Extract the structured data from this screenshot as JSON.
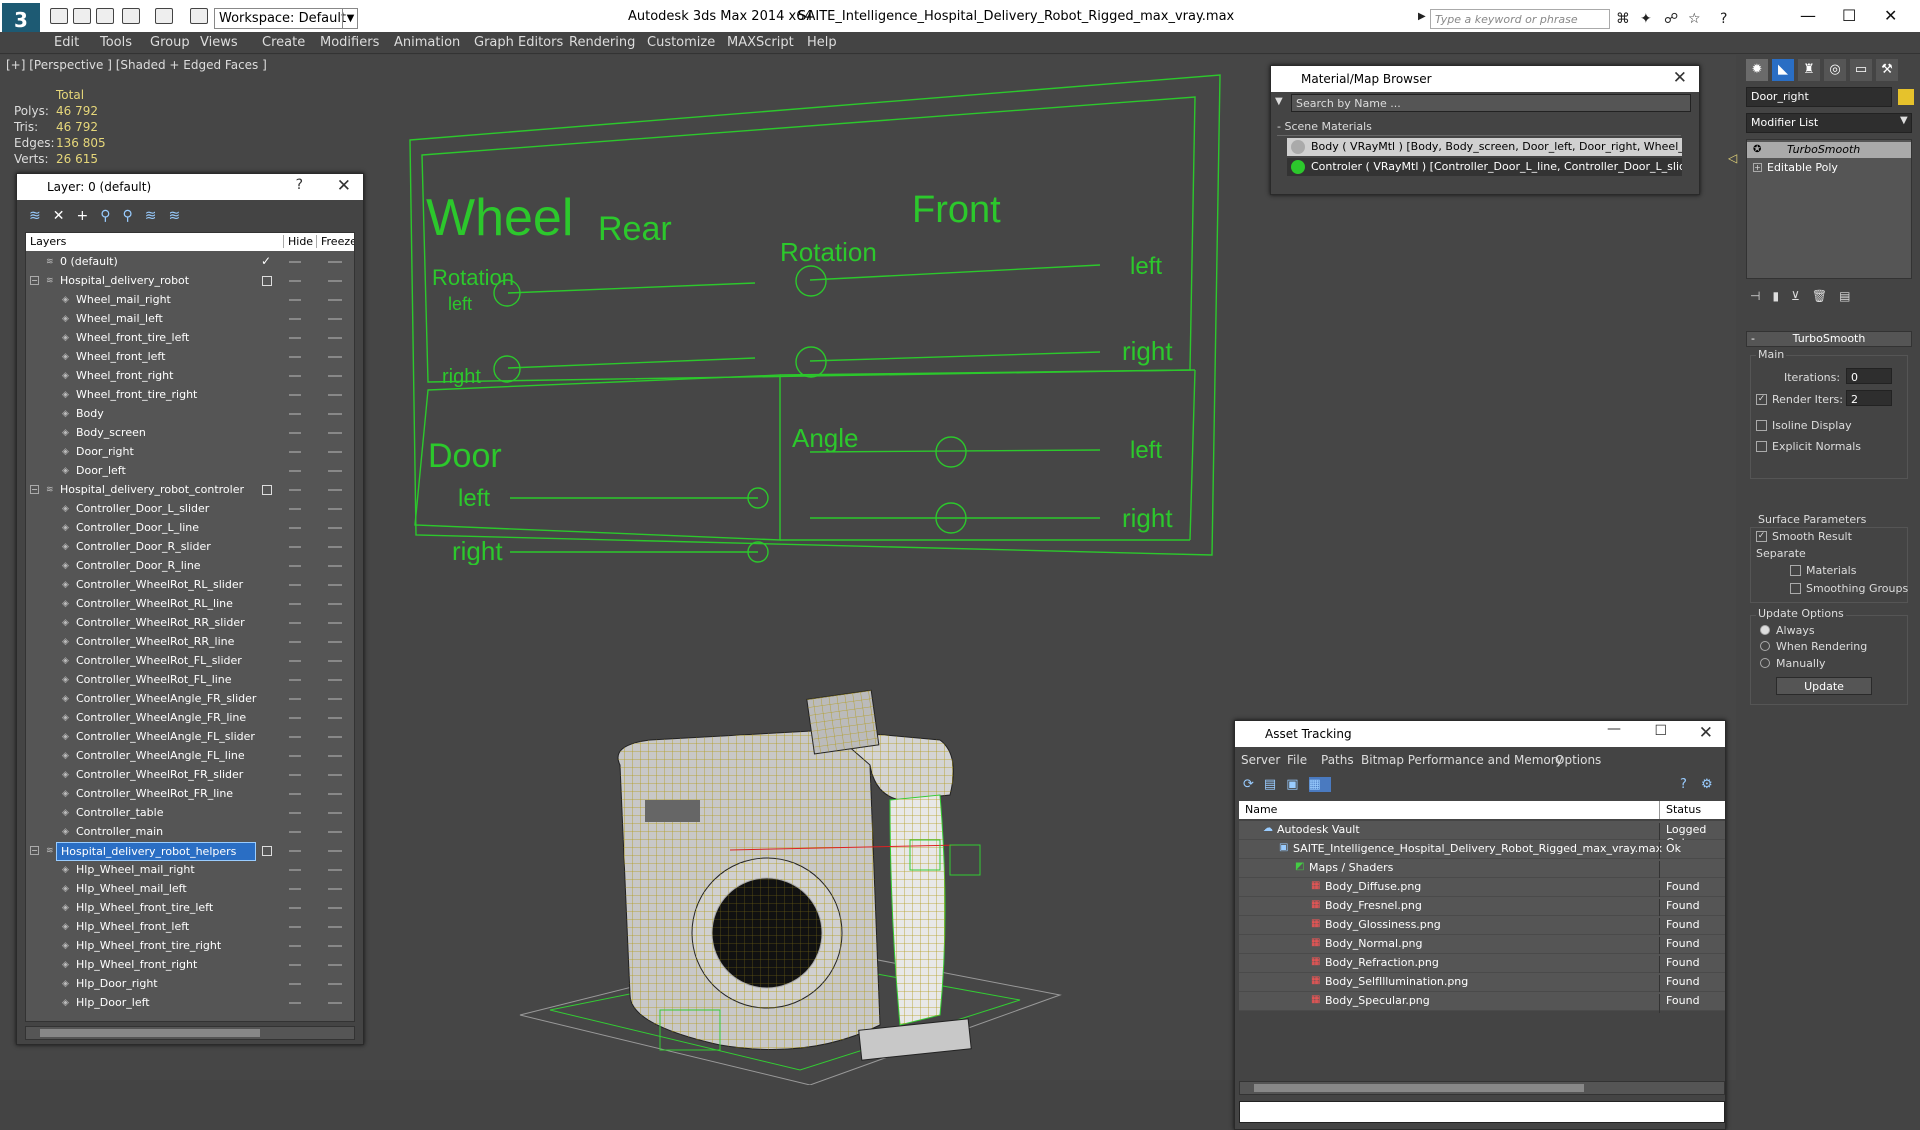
{
  "app": {
    "title": "Autodesk 3ds Max  2014 x64",
    "file": "SAITE_Intelligence_Hospital_Delivery_Robot_Rigged_max_vray.max",
    "workspace": "Workspace: Default",
    "search_placeholder": "Type a keyword or phrase",
    "logo": "3"
  },
  "menu": [
    "Edit",
    "Tools",
    "Group",
    "Views",
    "Create",
    "Modifiers",
    "Animation",
    "Graph Editors",
    "Rendering",
    "Customize",
    "MAXScript",
    "Help"
  ],
  "viewport": {
    "label": "[+] [Perspective ] [Shaded + Edged Faces ]",
    "stats": {
      "header": "Total",
      "polys_label": "Polys:",
      "polys": "46 792",
      "tris_label": "Tris:",
      "tris": "46 792",
      "edges_label": "Edges:",
      "edges": "136 805",
      "verts_label": "Verts:",
      "verts": "26 615"
    }
  },
  "rig_board": {
    "wheel": "Wheel",
    "rotation": "Rotation",
    "rear": "Rear",
    "front": "Front",
    "rotation2": "Rotation",
    "left": "left",
    "right": "right",
    "door": "Door",
    "angle": "Angle"
  },
  "layer_panel": {
    "title": "Layer: 0 (default)",
    "help": "?",
    "close": "✕",
    "col_layers": "Layers",
    "col_hide": "Hide",
    "col_freeze": "Freeze",
    "rows": [
      {
        "name": "0 (default)",
        "level": 0,
        "type": "layer"
      },
      {
        "name": "Hospital_delivery_robot",
        "level": 0,
        "type": "layer"
      },
      {
        "name": "Wheel_mail_right",
        "level": 1,
        "type": "obj"
      },
      {
        "name": "Wheel_mail_left",
        "level": 1,
        "type": "obj"
      },
      {
        "name": "Wheel_front_tire_left",
        "level": 1,
        "type": "obj"
      },
      {
        "name": "Wheel_front_left",
        "level": 1,
        "type": "obj"
      },
      {
        "name": "Wheel_front_right",
        "level": 1,
        "type": "obj"
      },
      {
        "name": "Wheel_front_tire_right",
        "level": 1,
        "type": "obj"
      },
      {
        "name": "Body",
        "level": 1,
        "type": "obj"
      },
      {
        "name": "Body_screen",
        "level": 1,
        "type": "obj"
      },
      {
        "name": "Door_right",
        "level": 1,
        "type": "obj"
      },
      {
        "name": "Door_left",
        "level": 1,
        "type": "obj"
      },
      {
        "name": "Hospital_delivery_robot_controler",
        "level": 0,
        "type": "layer"
      },
      {
        "name": "Controller_Door_L_slider",
        "level": 1,
        "type": "obj"
      },
      {
        "name": "Controller_Door_L_line",
        "level": 1,
        "type": "obj"
      },
      {
        "name": "Controller_Door_R_slider",
        "level": 1,
        "type": "obj"
      },
      {
        "name": "Controller_Door_R_line",
        "level": 1,
        "type": "obj"
      },
      {
        "name": "Controller_WheelRot_RL_slider",
        "level": 1,
        "type": "obj"
      },
      {
        "name": "Controller_WheelRot_RL_line",
        "level": 1,
        "type": "obj"
      },
      {
        "name": "Controller_WheelRot_RR_slider",
        "level": 1,
        "type": "obj"
      },
      {
        "name": "Controller_WheelRot_RR_line",
        "level": 1,
        "type": "obj"
      },
      {
        "name": "Controller_WheelRot_FL_slider",
        "level": 1,
        "type": "obj"
      },
      {
        "name": "Controller_WheelRot_FL_line",
        "level": 1,
        "type": "obj"
      },
      {
        "name": "Controller_WheelAngle_FR_slider",
        "level": 1,
        "type": "obj"
      },
      {
        "name": "Controller_WheelAngle_FR_line",
        "level": 1,
        "type": "obj"
      },
      {
        "name": "Controller_WheelAngle_FL_slider",
        "level": 1,
        "type": "obj"
      },
      {
        "name": "Controller_WheelAngle_FL_line",
        "level": 1,
        "type": "obj"
      },
      {
        "name": "Controller_WheelRot_FR_slider",
        "level": 1,
        "type": "obj"
      },
      {
        "name": "Controller_WheelRot_FR_line",
        "level": 1,
        "type": "obj"
      },
      {
        "name": "Controller_table",
        "level": 1,
        "type": "obj"
      },
      {
        "name": "Controller_main",
        "level": 1,
        "type": "obj"
      },
      {
        "name": "Hospital_delivery_robot_helpers",
        "level": 0,
        "type": "layer",
        "selected": true
      },
      {
        "name": "Hlp_Wheel_mail_right",
        "level": 1,
        "type": "obj"
      },
      {
        "name": "Hlp_Wheel_mail_left",
        "level": 1,
        "type": "obj"
      },
      {
        "name": "Hlp_Wheel_front_tire_left",
        "level": 1,
        "type": "obj"
      },
      {
        "name": "Hlp_Wheel_front_left",
        "level": 1,
        "type": "obj"
      },
      {
        "name": "Hlp_Wheel_front_tire_right",
        "level": 1,
        "type": "obj"
      },
      {
        "name": "Hlp_Wheel_front_right",
        "level": 1,
        "type": "obj"
      },
      {
        "name": "Hlp_Door_right",
        "level": 1,
        "type": "obj"
      },
      {
        "name": "Hlp_Door_left",
        "level": 1,
        "type": "obj"
      }
    ]
  },
  "material_browser": {
    "title": "Material/Map Browser",
    "search_placeholder": "Search by Name ...",
    "section": "- Scene Materials",
    "items": [
      {
        "label": "Body  ( VRayMtl ) [Body, Body_screen, Door_left, Door_right, Wheel_fr..."
      },
      {
        "label": "Controler  ( VRayMtl ) [Controller_Door_L_line, Controller_Door_L_slid..."
      }
    ]
  },
  "asset_tracking": {
    "title": "Asset Tracking",
    "menu": [
      "Server",
      "File",
      "Paths",
      "Bitmap Performance and Memory",
      "Options"
    ],
    "col_name": "Name",
    "col_status": "Status",
    "rows": [
      {
        "name": "Autodesk Vault",
        "status": "Logged Out",
        "indent": 1
      },
      {
        "name": "SAITE_Intelligence_Hospital_Delivery_Robot_Rigged_max_vray.max",
        "status": "Ok",
        "indent": 2
      },
      {
        "name": "Maps / Shaders",
        "status": "",
        "indent": 3
      },
      {
        "name": "Body_Diffuse.png",
        "status": "Found",
        "indent": 4
      },
      {
        "name": "Body_Fresnel.png",
        "status": "Found",
        "indent": 4
      },
      {
        "name": "Body_Glossiness.png",
        "status": "Found",
        "indent": 4
      },
      {
        "name": "Body_Normal.png",
        "status": "Found",
        "indent": 4
      },
      {
        "name": "Body_Refraction.png",
        "status": "Found",
        "indent": 4
      },
      {
        "name": "Body_SelfIllumination.png",
        "status": "Found",
        "indent": 4
      },
      {
        "name": "Body_Specular.png",
        "status": "Found",
        "indent": 4
      }
    ]
  },
  "command_panel": {
    "object_name": "Door_right",
    "modifier_list": "Modifier List",
    "stack": [
      "TurboSmooth",
      "Editable Poly"
    ],
    "rollout": "TurboSmooth",
    "main": "Main",
    "iterations_label": "Iterations:",
    "iterations": "0",
    "render_iters_label": "Render Iters:",
    "render_iters": "2",
    "isoline": "Isoline Display",
    "explicit_normals": "Explicit Normals",
    "surface_params": "Surface Parameters",
    "smooth_result": "Smooth Result",
    "separate": "Separate",
    "materials": "Materials",
    "smoothing_groups": "Smoothing Groups",
    "update_options": "Update Options",
    "always": "Always",
    "when_rendering": "When Rendering",
    "manually": "Manually",
    "update_btn": "Update"
  }
}
